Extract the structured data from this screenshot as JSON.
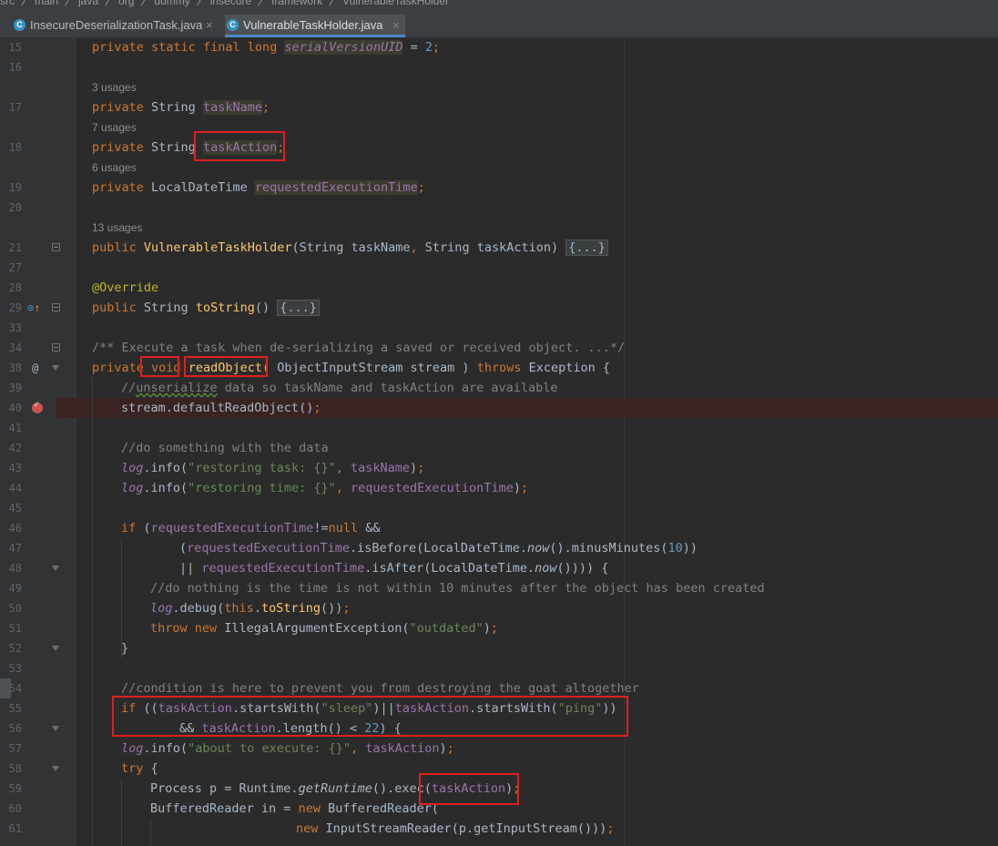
{
  "breadcrumb": "src  〉 main  〉 java  〉 org  〉 dummy  〉 insecure  〉 framework  〉 VulnerableTaskHolder",
  "tabs": [
    {
      "label": "InsecureDeserializationTask.java",
      "icon": "C"
    },
    {
      "label": "VulnerableTaskHolder.java",
      "icon": "C"
    }
  ],
  "lines": {
    "15": "private static final long serialVersionUID = 2;",
    "17": "private String taskName;",
    "18": "private String taskAction;",
    "19": "private LocalDateTime requestedExecutionTime;",
    "21": "public VulnerableTaskHolder(String taskName, String taskAction) {...}",
    "28": "@Override",
    "29": "public String toString() {...}",
    "34": "/** Execute a task when de-serializing a saved or received object. ...*/",
    "38": "private void readObject( ObjectInputStream stream ) throws Exception {",
    "39": "//unserialize data so taskName and taskAction are available",
    "40": "stream.defaultReadObject();",
    "42": "//do something with the data",
    "43": "log.info(\"restoring task: {}\", taskName);",
    "44": "log.info(\"restoring time: {}\", requestedExecutionTime);",
    "46": "if (requestedExecutionTime!=null &&",
    "47": "(requestedExecutionTime.isBefore(LocalDateTime.now().minusMinutes(10))",
    "48": "|| requestedExecutionTime.isAfter(LocalDateTime.now()))) {",
    "49": "//do nothing is the time is not within 10 minutes after the object has been created",
    "50": "log.debug(this.toString());",
    "51": "throw new IllegalArgumentException(\"outdated\");",
    "52": "}",
    "54": "//condition is here to prevent you from destroying the goat altogether",
    "55": "if ((taskAction.startsWith(\"sleep\")||taskAction.startsWith(\"ping\"))",
    "56": "&& taskAction.length() < 22) {",
    "57": "log.info(\"about to execute: {}\", taskAction);",
    "58": "try {",
    "59": "Process p = Runtime.getRuntime().exec(taskAction);",
    "60": "BufferedReader in = new BufferedReader(",
    "61": "new InputStreamReader(p.getInputStream()));"
  },
  "usages": {
    "17": "3 usages",
    "18": "7 usages",
    "19": "6 usages",
    "21": "13 usages"
  },
  "line_numbers": [
    "15",
    "16",
    "17",
    "18",
    "19",
    "20",
    "21",
    "27",
    "28",
    "29",
    "33",
    "34",
    "38",
    "39",
    "40",
    "41",
    "42",
    "43",
    "44",
    "45",
    "46",
    "47",
    "48",
    "49",
    "50",
    "51",
    "52",
    "53",
    "54",
    "55",
    "56",
    "57",
    "58",
    "59",
    "60",
    "61"
  ],
  "colors": {
    "keyword": "#cc7832",
    "string": "#6a8759",
    "number": "#6897bb",
    "field": "#9876aa",
    "method": "#ffc66d",
    "comment": "#808080",
    "annotation": "#bbb529",
    "highlight_box": "#e01f1f"
  },
  "icons": {
    "tab": "java-class-icon",
    "gutter_29": "override-method-icon",
    "gutter_38": "implements-icon",
    "gutter_40": "breakpoint-icon"
  }
}
